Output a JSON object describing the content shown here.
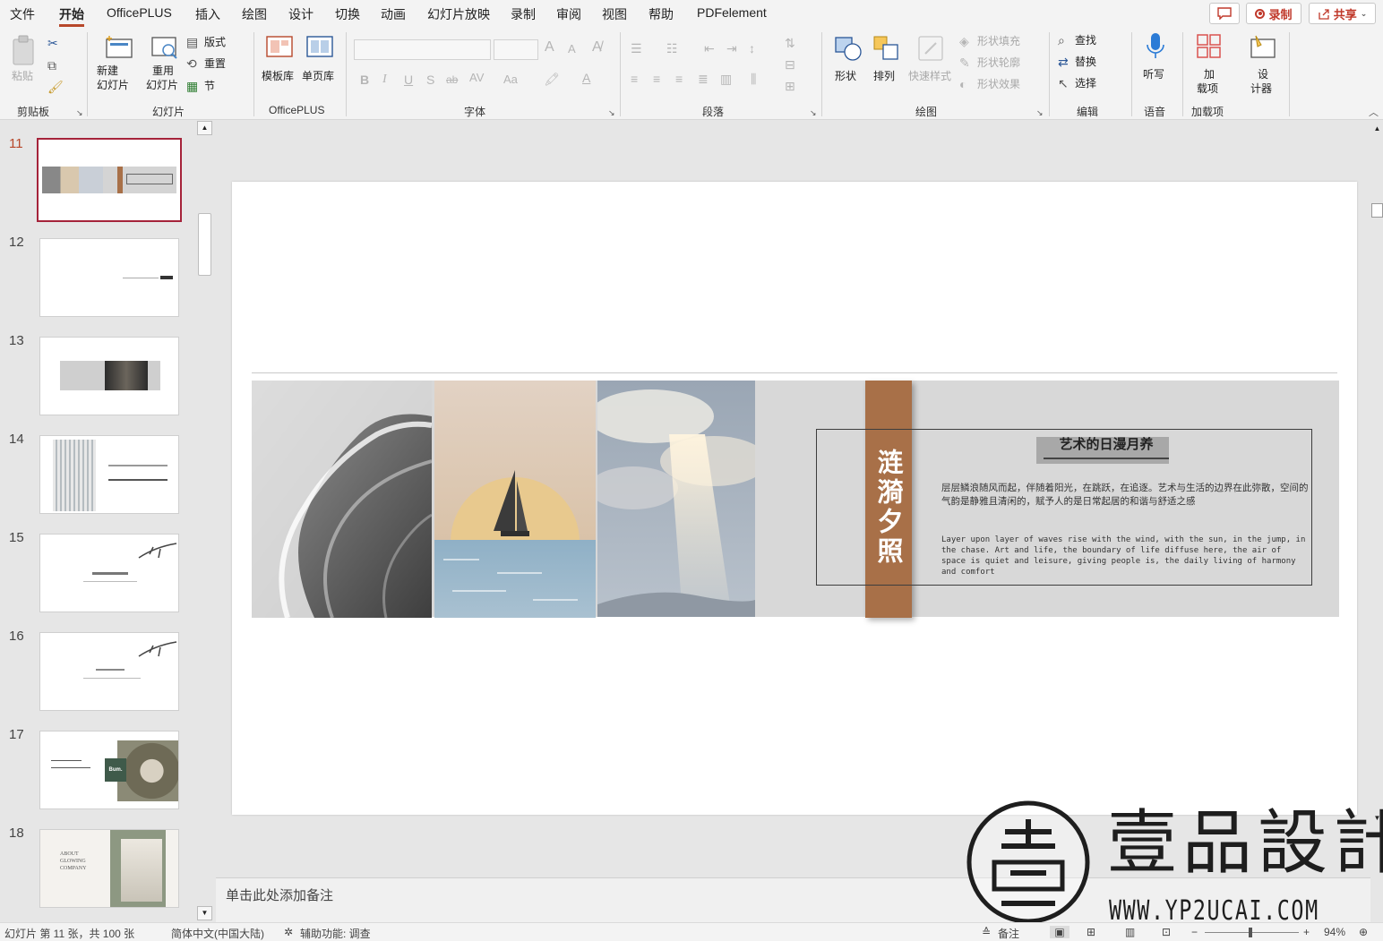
{
  "menu": {
    "items": [
      "文件",
      "开始",
      "OfficePLUS",
      "插入",
      "绘图",
      "设计",
      "切换",
      "动画",
      "幻灯片放映",
      "录制",
      "审阅",
      "视图",
      "帮助",
      "PDFelement"
    ],
    "active_index": 1,
    "record_label": "录制",
    "share_label": "共享"
  },
  "ribbon": {
    "clipboard": {
      "group": "剪贴板",
      "paste": "粘贴"
    },
    "slides": {
      "group": "幻灯片",
      "new_slide_1": "新建",
      "new_slide_2": "幻灯片",
      "reuse_1": "重用",
      "reuse_2": "幻灯片",
      "layout": "版式",
      "reset": "重置",
      "section": "节"
    },
    "officeplus": {
      "group": "OfficePLUS",
      "template": "模板库",
      "single": "单页库"
    },
    "font": {
      "group": "字体",
      "bold": "B",
      "italic": "I",
      "underline": "U",
      "strike": "S",
      "ab": "ab",
      "spacing": "AV",
      "case": "Aa",
      "grow": "A",
      "shrink": "A"
    },
    "paragraph": {
      "group": "段落"
    },
    "drawing": {
      "group": "绘图",
      "shapes": "形状",
      "arrange": "排列",
      "quick_styles": "快速样式",
      "fill": "形状填充",
      "outline": "形状轮廓",
      "effects": "形状效果"
    },
    "editing": {
      "group": "编辑",
      "find": "查找",
      "replace": "替换",
      "select": "选择"
    },
    "voice": {
      "group": "语音",
      "dictate": "听写"
    },
    "addins": {
      "group": "加载项",
      "addins_1": "加",
      "addins_2": "载项",
      "designer_1": "设",
      "designer_2": "计器"
    }
  },
  "thumbnails": {
    "numbers": [
      "11",
      "12",
      "13",
      "14",
      "15",
      "16",
      "17",
      "18"
    ],
    "selected": "11",
    "t17_text": "Bum.",
    "t18_text_1": "ABOUT",
    "t18_text_2": "GLOWING",
    "t18_text_3": "COMPANY"
  },
  "slide": {
    "vertical_title": "涟漪夕照",
    "heading": "艺术的日漫月养",
    "body_cn": "层层鳞浪随风而起，伴随着阳光，在跳跃，在追逐。艺术与生活的边界在此弥散，空间的气韵是静雅且清闲的，赋予人的是日常起居的和谐与舒适之感",
    "body_en": "Layer upon layer of waves rise with the wind, with the sun, in the jump, in the chase. Art and life, the boundary of life diffuse here, the air of space is quiet and leisure, giving people is, the daily living of harmony and comfort",
    "accent_color": "#a87048"
  },
  "notes": {
    "placeholder": "单击此处添加备注"
  },
  "status": {
    "slide_info": "幻灯片 第 11 张，共 100 张",
    "language": "简体中文(中国大陆)",
    "accessibility": "辅助功能: 调查",
    "notes_btn": "备注",
    "zoom": "94%"
  },
  "watermark": {
    "brand": "壹品設計",
    "url": "WWW.YP2UCAI.COM"
  }
}
